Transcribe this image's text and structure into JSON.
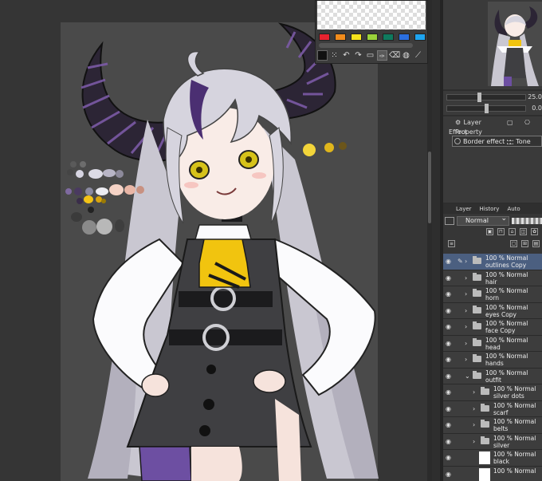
{
  "colors": {
    "swatches": [
      "#e8232f",
      "#f28c1c",
      "#f5e21c",
      "#9ad23a",
      "#0f7a5e",
      "#2b6fe0",
      "#1ea4ef"
    ],
    "active_color": "#111111"
  },
  "color_set": {
    "tool_icons": [
      "brush-icon",
      "undo-icon",
      "redo-icon",
      "mode-icon",
      "pen-icon",
      "eraser-icon",
      "drop-icon",
      "eyedropper-icon"
    ]
  },
  "navigator": {
    "zoom": "25.0",
    "rotation": "0.0"
  },
  "property": {
    "tab_label": "Layer Property",
    "effect_label": "Effect",
    "border_effect": "Border effect",
    "tone": "Tone"
  },
  "layer_panel": {
    "tabs": [
      "Layer",
      "History",
      "Auto"
    ],
    "blend_mode": "Normal"
  },
  "layers": [
    {
      "opacity": "100 %",
      "mode": "Normal",
      "name": "outlines Copy",
      "type": "folder",
      "indent": 0,
      "selected": true,
      "expanded": false
    },
    {
      "opacity": "100 %",
      "mode": "Normal",
      "name": "hair",
      "type": "folder",
      "indent": 0,
      "selected": false,
      "expanded": false
    },
    {
      "opacity": "100 %",
      "mode": "Normal",
      "name": "horn",
      "type": "folder",
      "indent": 0,
      "selected": false,
      "expanded": false
    },
    {
      "opacity": "100 %",
      "mode": "Normal",
      "name": "eyes Copy",
      "type": "folder",
      "indent": 0,
      "selected": false,
      "expanded": false
    },
    {
      "opacity": "100 %",
      "mode": "Normal",
      "name": "face Copy",
      "type": "folder",
      "indent": 0,
      "selected": false,
      "expanded": false
    },
    {
      "opacity": "100 %",
      "mode": "Normal",
      "name": "head",
      "type": "folder",
      "indent": 0,
      "selected": false,
      "expanded": false
    },
    {
      "opacity": "100 %",
      "mode": "Normal",
      "name": "hands",
      "type": "folder",
      "indent": 0,
      "selected": false,
      "expanded": false
    },
    {
      "opacity": "100 %",
      "mode": "Normal",
      "name": "outfit",
      "type": "folder",
      "indent": 0,
      "selected": false,
      "expanded": true
    },
    {
      "opacity": "100 %",
      "mode": "Normal",
      "name": "silver dots",
      "type": "folder",
      "indent": 1,
      "selected": false,
      "expanded": false
    },
    {
      "opacity": "100 %",
      "mode": "Normal",
      "name": "scarf",
      "type": "folder",
      "indent": 1,
      "selected": false,
      "expanded": false
    },
    {
      "opacity": "100 %",
      "mode": "Normal",
      "name": "belts",
      "type": "folder",
      "indent": 1,
      "selected": false,
      "expanded": false
    },
    {
      "opacity": "100 %",
      "mode": "Normal",
      "name": "silver",
      "type": "folder",
      "indent": 1,
      "selected": false,
      "expanded": false
    },
    {
      "opacity": "100 %",
      "mode": "Normal",
      "name": "black",
      "type": "raster",
      "indent": 1,
      "selected": false,
      "expanded": false
    },
    {
      "opacity": "100 %",
      "mode": "Normal",
      "name": "",
      "type": "raster",
      "indent": 1,
      "selected": false,
      "expanded": false
    }
  ]
}
